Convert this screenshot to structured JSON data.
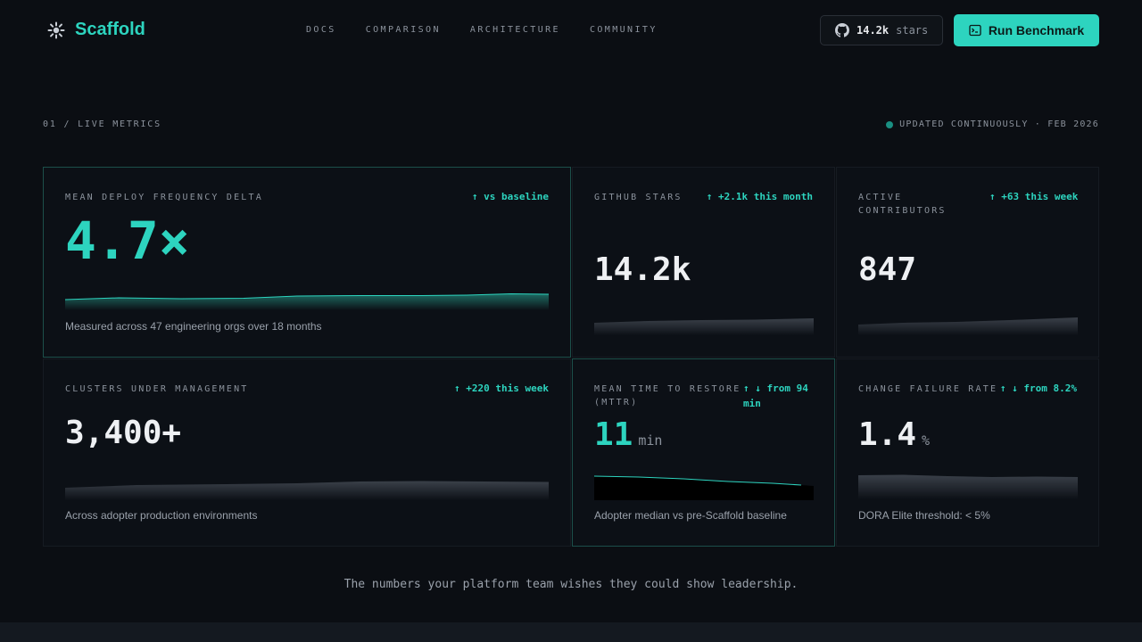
{
  "brand": {
    "name": "Scaffold"
  },
  "nav": [
    {
      "label": "DOCS"
    },
    {
      "label": "COMPARISON"
    },
    {
      "label": "ARCHITECTURE"
    },
    {
      "label": "COMMUNITY"
    }
  ],
  "github": {
    "count": "14.2k",
    "label": "stars"
  },
  "cta": {
    "label": "Run Benchmark"
  },
  "section": {
    "label": "01 / LIVE METRICS",
    "updated": "UPDATED CONTINUOUSLY · FEB 2026"
  },
  "cards": {
    "deploy": {
      "title": "MEAN DEPLOY FREQUENCY DELTA",
      "delta": "↑ vs baseline",
      "value": "4.7×",
      "caption": "Measured across 47 engineering orgs over 18 months"
    },
    "stars": {
      "title": "GITHUB STARS",
      "delta": "↑ +2.1k this month",
      "value": "14.2k"
    },
    "contributors": {
      "title": "ACTIVE CONTRIBUTORS",
      "delta": "↑ +63 this week",
      "value": "847"
    },
    "clusters": {
      "title": "CLUSTERS UNDER MANAGEMENT",
      "delta": "↑ +220 this week",
      "value": "3,400+",
      "caption": "Across adopter production environments"
    },
    "mttr": {
      "title": "MEAN TIME TO RESTORE (MTTR)",
      "delta": "↑ ↓ from 94 min",
      "value": "11",
      "unit": "min",
      "caption": "Adopter median vs pre-Scaffold baseline"
    },
    "cfr": {
      "title": "CHANGE FAILURE RATE",
      "delta": "↑ ↓ from 8.2%",
      "value": "1.4",
      "unit": "%",
      "caption": "DORA Elite threshold: < 5%"
    }
  },
  "tagline": "The numbers your platform team wishes they could show leadership.",
  "colors": {
    "accent": "#2dd4bf",
    "background": "#0b0e13"
  }
}
